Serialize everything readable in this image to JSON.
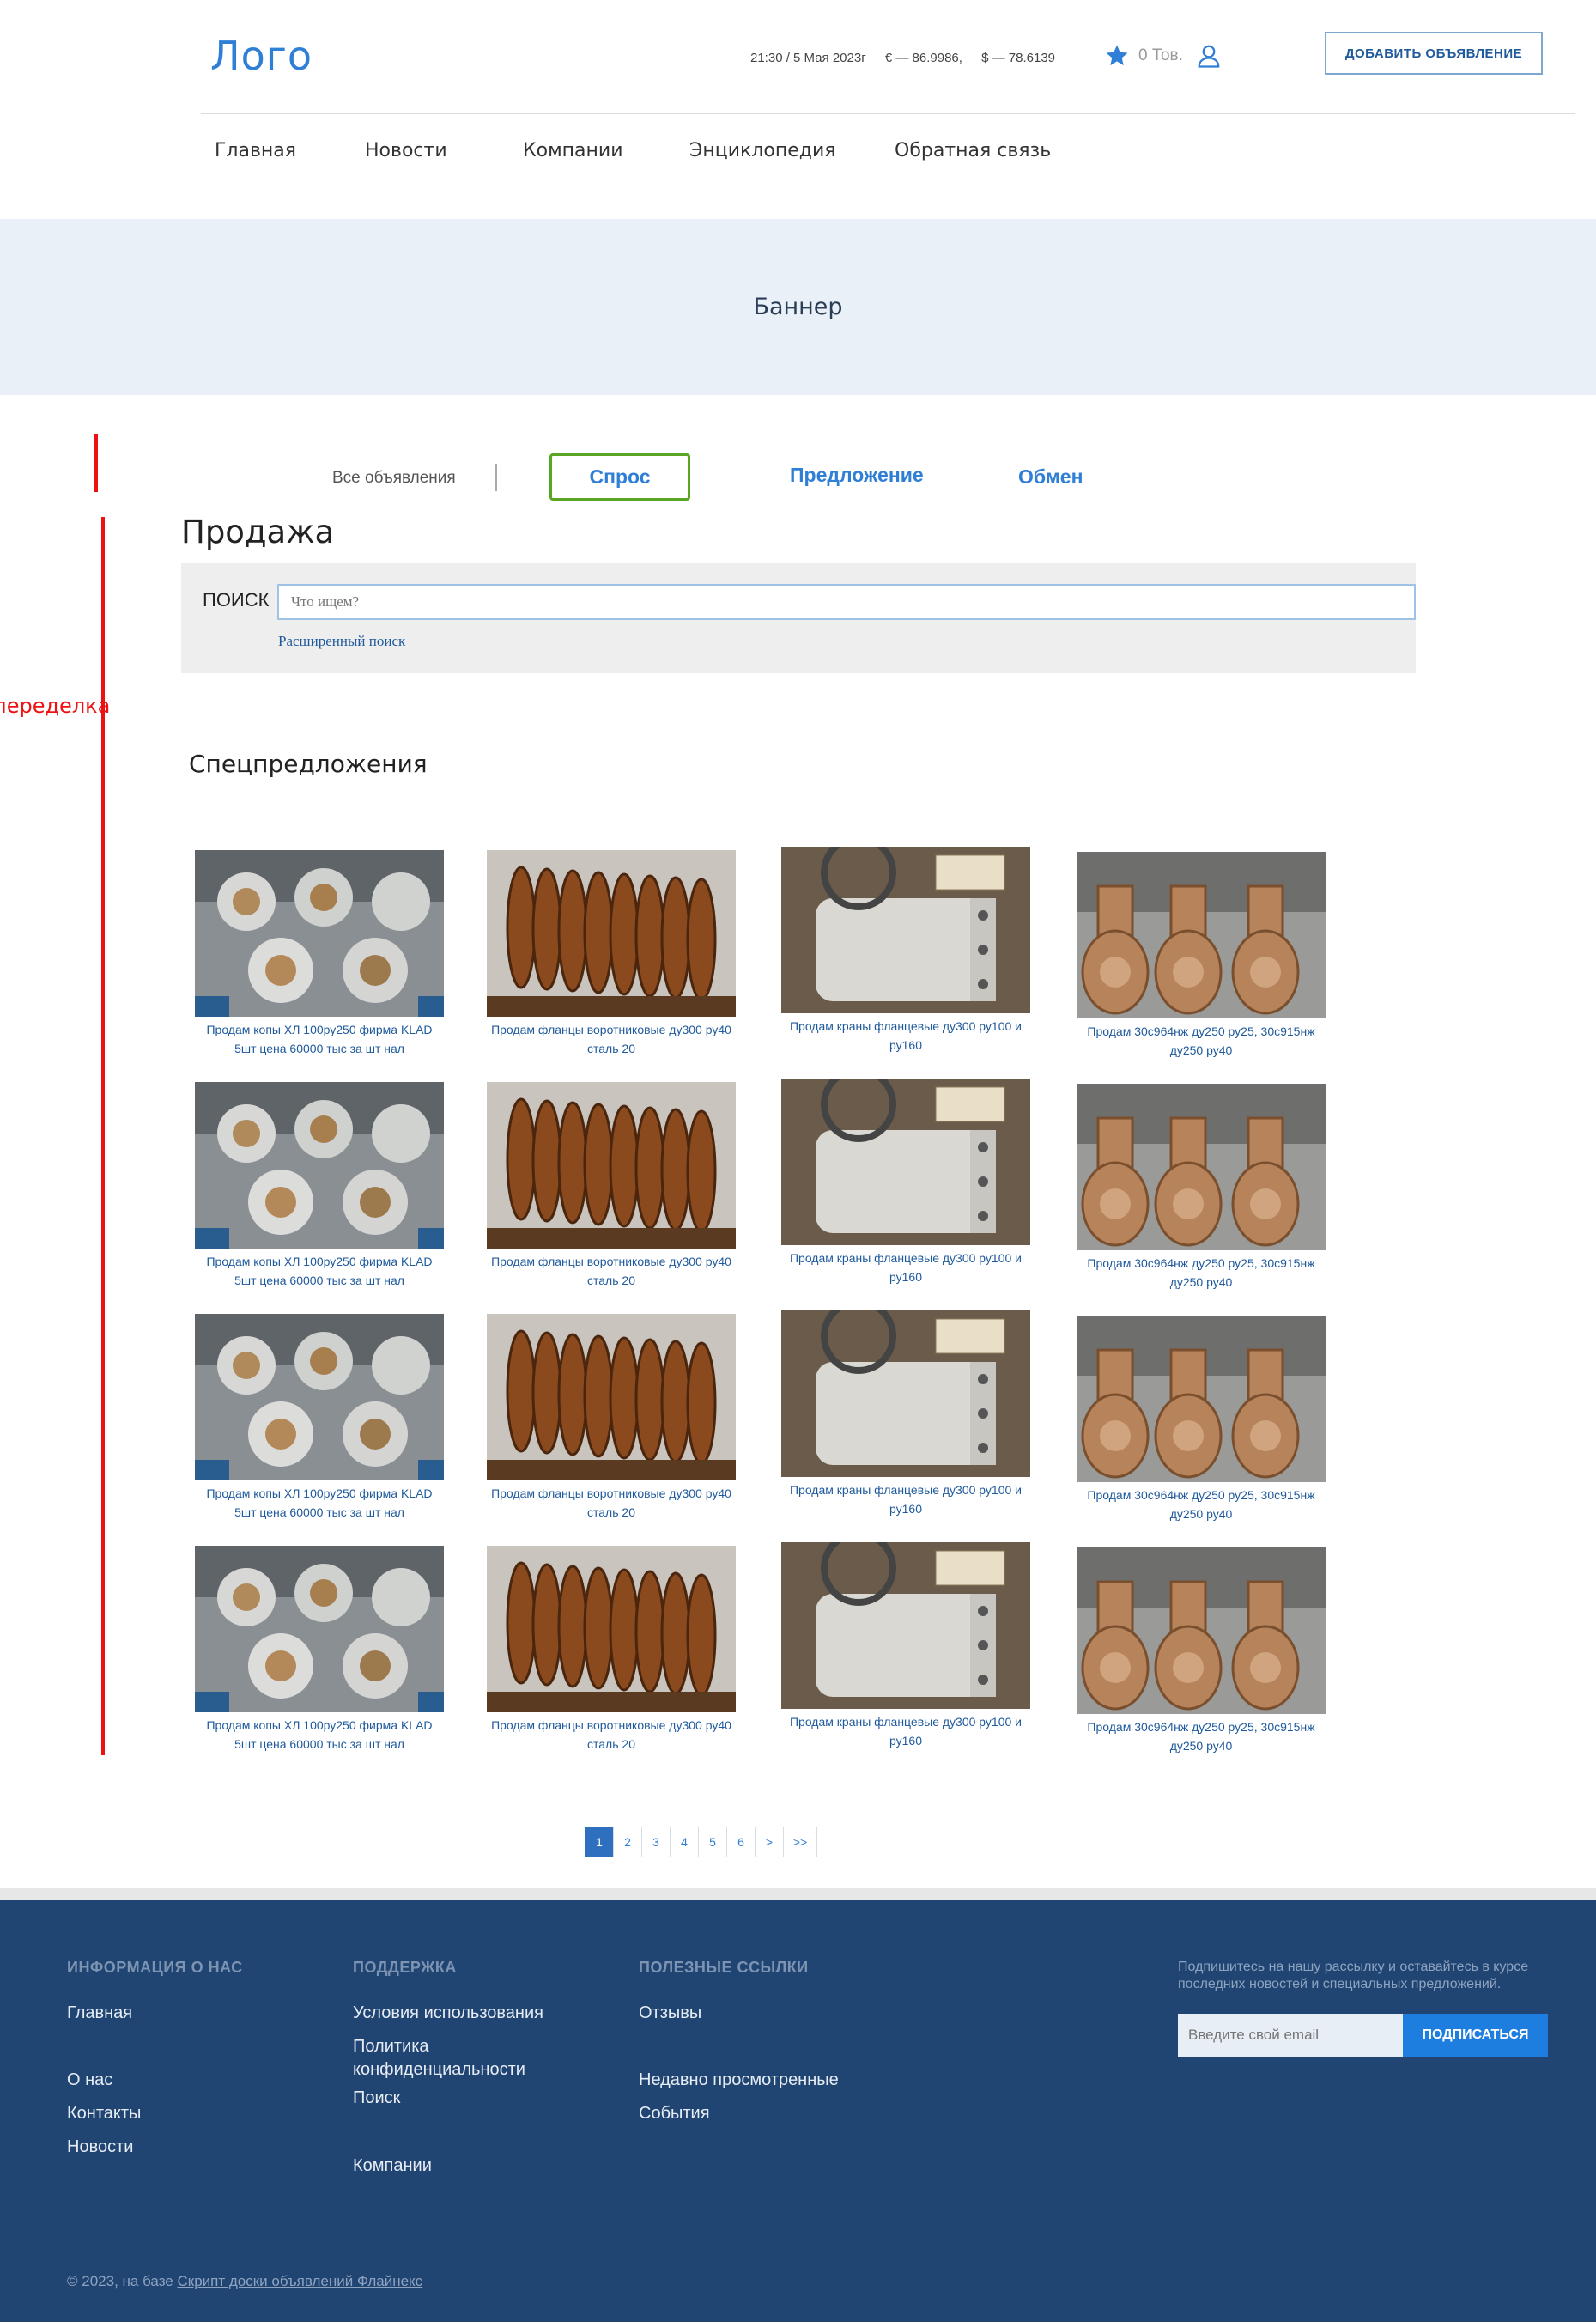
{
  "header": {
    "logo": "Лого",
    "datetime": "21:30 / 5 Мая 2023г",
    "euro": "€ — 86.9986,",
    "usd": "$ — 78.6139",
    "favorites": "0 Тов.",
    "add_button": "ДОБАВИТЬ ОБЪЯВЛЕНИЕ"
  },
  "nav": [
    "Главная",
    "Новости",
    "Компании",
    "Энциклопедия",
    "Обратная связь"
  ],
  "banner": "Баннер",
  "annotation": "переделка",
  "tabs": {
    "all": "Все объявления",
    "demand": "Спрос",
    "offer": "Предложение",
    "exchange": "Обмен"
  },
  "sale_title": "Продажа",
  "search": {
    "label": "ПОИСК",
    "placeholder": "Что ищем?",
    "advanced": "Расширенный поиск"
  },
  "special_title": "Спецпредложения",
  "products": [
    "Продам копы ХЛ 100ру250 фирма KLAD 5шт цена 60000 тыс за шт нал",
    "Продам фланцы воротниковые ду300 ру40 сталь 20",
    "Продам краны фланцевые ду300 ру100 и ру160",
    "Продам 30с964нж ду250 ру25, 30с915нж ду250 ру40"
  ],
  "pagination": [
    "1",
    "2",
    "3",
    "4",
    "5",
    "6",
    ">",
    ">>"
  ],
  "footer": {
    "col1_head": "ИНФОРМАЦИЯ О НАС",
    "col1": [
      "Главная",
      "О нас",
      "Контакты",
      "Новости"
    ],
    "col2_head": "ПОДДЕРЖКА",
    "col2": [
      "Условия использования",
      "Политика конфиденциальности",
      "Поиск",
      "Компании"
    ],
    "col3_head": "ПОЛЕЗНЫЕ ССЫЛКИ",
    "col3": [
      "Отзывы",
      "Недавно просмотренные",
      "События"
    ],
    "subscribe_text": "Подпишитесь на нашу рассылку и оставайтесь в курсе последних новостей и специальных предложений.",
    "email_placeholder": "Введите свой email",
    "subscribe_button": "ПОДПИСАТЬСЯ",
    "copyright": "© 2023, на базе ",
    "copyright_link": "Скрипт доски объявлений Флайнекс"
  },
  "colors": {
    "accent": "#2f7fd6",
    "footer_bg": "#214572",
    "banner_bg": "#e9f0f8",
    "annotation": "#e11111",
    "active_tab_border": "#5aa624"
  }
}
